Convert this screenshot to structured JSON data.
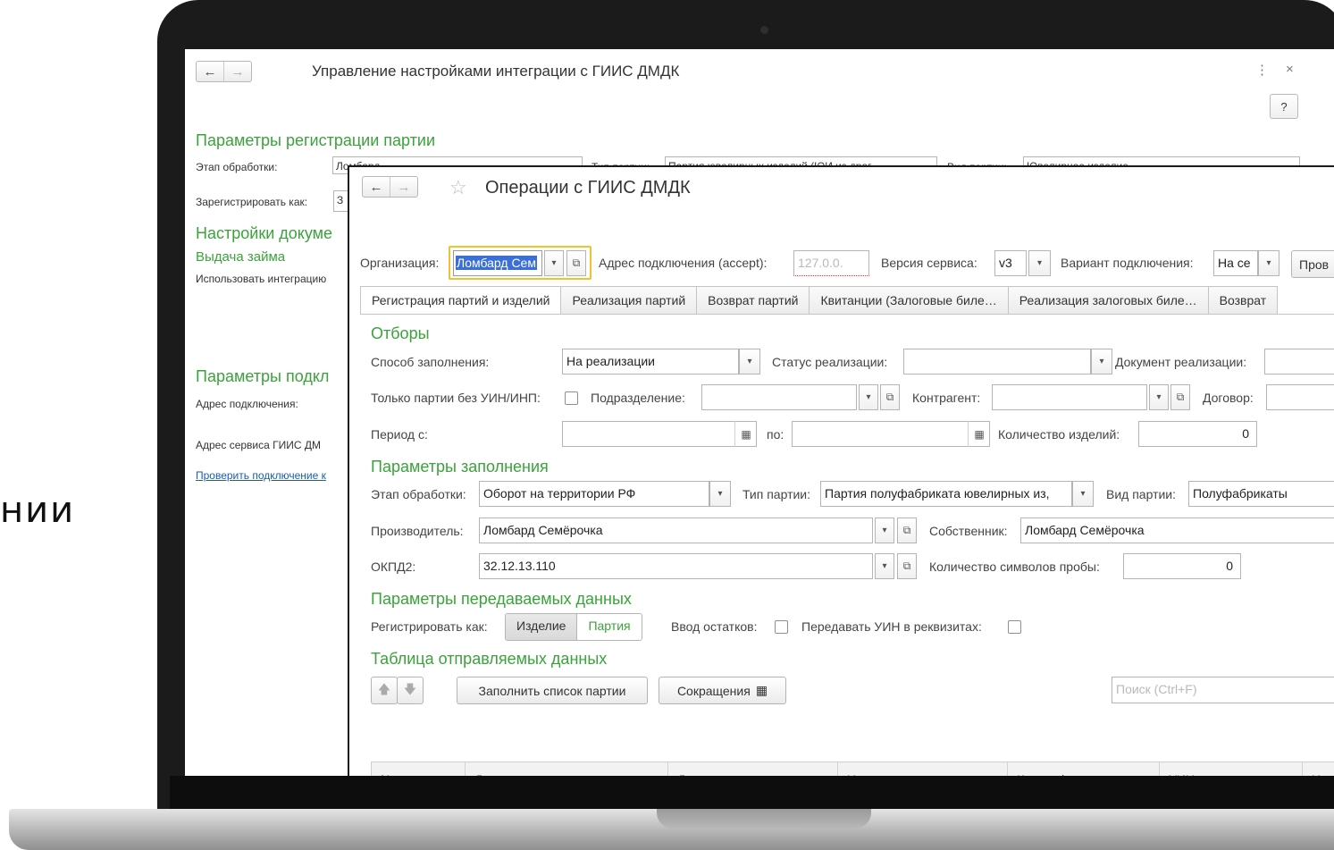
{
  "side_text": "нии",
  "back": {
    "title": "Управление настройками интеграции с ГИИС ДМДК",
    "menu_icon": "⋮",
    "close_icon": "×",
    "help_label": "?",
    "section_registration": "Параметры регистрации партии",
    "stage_label": "Этап обработки:",
    "stage_value": "Ломбард",
    "batch_type_label": "Тип партии:",
    "batch_type_value": "Партия ювелирных изделий (ЮИ из драг",
    "batch_kind_label": "Вид партии:",
    "batch_kind_value": "Ювелирное изделие",
    "register_as_label": "Зарегистрировать как:",
    "register_as_value": "З",
    "section_docs": "Настройки докуме",
    "loan_issue": "Выдача займа",
    "use_integration": "Использовать интеграцию",
    "section_connection": "Параметры подкл",
    "connection_address": "Адрес подключения:",
    "service_address": "Адрес сервиса ГИИС ДМ",
    "check_connection_link": "Проверить подключение к"
  },
  "front": {
    "title": "Операции с ГИИС ДМДК",
    "org_label": "Организация:",
    "org_value": "Ломбард Сем",
    "address_label": "Адрес подключения (accept):",
    "address_value": "127.0.0.",
    "version_label": "Версия сервиса:",
    "version_value": "v3",
    "variant_label": "Вариант подключения:",
    "variant_value": "На се",
    "check_button": "Пров",
    "tabs": [
      "Регистрация партий и изделий",
      "Реализация партий",
      "Возврат партий",
      "Квитанции (Залоговые биле…",
      "Реализация залоговых биле…",
      "Возврат"
    ],
    "filters": {
      "heading": "Отборы",
      "fill_method_label": "Способ заполнения:",
      "fill_method_value": "На реализации",
      "sale_status_label": "Статус реализации:",
      "sale_doc_label": "Документ реализации:",
      "no_uin_label": "Только партии без УИН/ИНП:",
      "division_label": "Подразделение:",
      "counterparty_label": "Контрагент:",
      "contract_label": "Договор:",
      "period_label": "Период с:",
      "period_from_value": " .  .      :  :",
      "period_to_label": "по:",
      "period_to_value": " .  .      :  :",
      "items_count_label": "Количество изделий:",
      "items_count_value": "0"
    },
    "fill_params": {
      "heading": "Параметры заполнения",
      "stage_label": "Этап обработки:",
      "stage_value": "Оборот на территории РФ",
      "batch_type_label": "Тип партии:",
      "batch_type_value": "Партия полуфабриката ювелирных из,",
      "batch_kind_label": "Вид партии:",
      "batch_kind_value": "Полуфабрикаты",
      "producer_label": "Производитель:",
      "producer_value": "Ломбард Семёрочка",
      "owner_label": "Собственник:",
      "owner_value": "Ломбард Семёрочка",
      "okpd_label": "ОКПД2:",
      "okpd_value": "32.12.13.110",
      "assay_chars_label": "Количество символов пробы:",
      "assay_chars_value": "0"
    },
    "transfer_params": {
      "heading": "Параметры передаваемых данных",
      "register_as_label": "Регистрировать как:",
      "option_item": "Изделие",
      "option_batch": "Партия",
      "input_balances_label": "Ввод остатков:",
      "pass_uin_label": "Передавать УИН в реквизитах:"
    },
    "table": {
      "heading": "Таблица отправляемых данных",
      "fill_batch_button": "Заполнить список партии",
      "abbreviations_button": "Сокращения",
      "search_placeholder": "Поиск (Ctrl+F)",
      "columns": [
        "№",
        "Дата выдачи",
        "Договор контрагента",
        "Номенклатура",
        "Классификация партии",
        "УИН",
        "Наи"
      ]
    }
  },
  "colors": {
    "accent_green": "#3aa33a",
    "focus_yellow": "#f2c12e",
    "selection_blue": "#3a6fd8"
  }
}
